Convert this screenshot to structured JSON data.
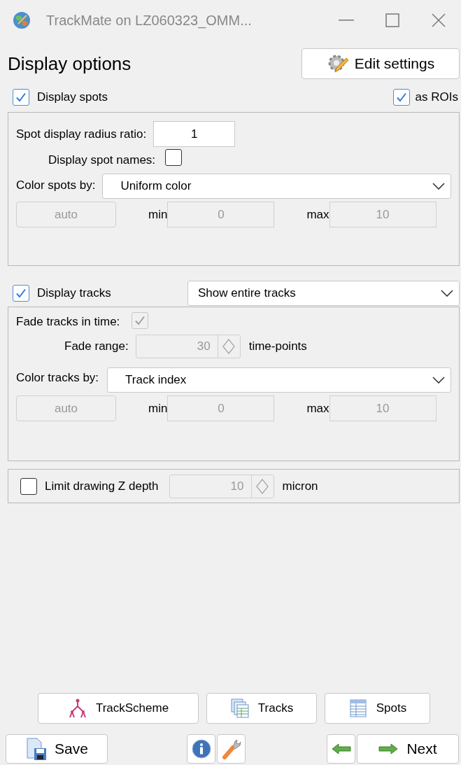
{
  "window": {
    "title": "TrackMate on LZ060323_OMM..."
  },
  "header": {
    "title": "Display options",
    "edit_button": "Edit settings"
  },
  "spots": {
    "display": {
      "label": "Display spots",
      "checked": true
    },
    "as_rois": {
      "label": "as ROIs",
      "checked": true
    },
    "radius": {
      "label": "Spot display radius ratio:",
      "value": "1"
    },
    "names": {
      "label": "Display spot names:",
      "checked": false
    },
    "color_by": {
      "label": "Color spots by:",
      "value": "Uniform color"
    },
    "range": {
      "auto": "auto",
      "min_label": "min",
      "min": "0",
      "max_label": "max",
      "max": "10",
      "disabled": true
    }
  },
  "tracks": {
    "display": {
      "label": "Display tracks",
      "checked": true
    },
    "mode": "Show entire tracks",
    "fade": {
      "label": "Fade tracks in time:",
      "checked": true,
      "disabled": true
    },
    "fade_range": {
      "label": "Fade range:",
      "value": "30",
      "unit": "time-points",
      "disabled": true
    },
    "color_by": {
      "label": "Color tracks by:",
      "value": "Track index"
    },
    "range": {
      "auto": "auto",
      "min_label": "min",
      "min": "0",
      "max_label": "max",
      "max": "10",
      "disabled": true
    }
  },
  "z_depth": {
    "label": "Limit drawing Z depth",
    "checked": false,
    "value": "10",
    "unit": "micron",
    "disabled": true
  },
  "view_buttons": [
    {
      "kind": "trackscheme",
      "label": "TrackScheme"
    },
    {
      "kind": "tracks",
      "label": "Tracks"
    },
    {
      "kind": "spots",
      "label": "Spots"
    }
  ],
  "nav": {
    "save": "Save",
    "next": "Next"
  }
}
